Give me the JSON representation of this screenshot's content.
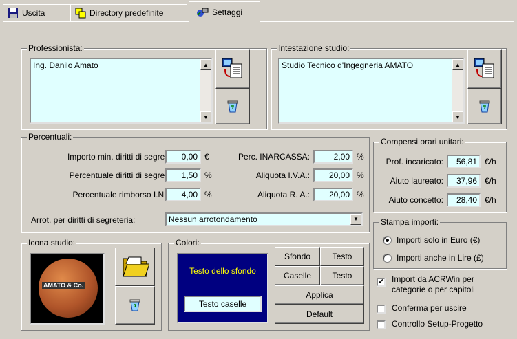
{
  "tabs": [
    {
      "label": "Uscita",
      "icon": "floppy-disk-icon"
    },
    {
      "label": "Directory predefinite",
      "icon": "copy-directory-icon"
    },
    {
      "label": "Settaggi",
      "icon": "settings-icon"
    }
  ],
  "professionista": {
    "legend": "Professionista:",
    "value": "Ing. Danilo Amato"
  },
  "intestazione": {
    "legend": "Intestazione studio:",
    "value": "Studio Tecnico d'Ingegneria AMATO"
  },
  "percentuali": {
    "legend": "Percentuali:",
    "importo_min": {
      "label": "Importo min. diritti di segreteria:",
      "value": "0,00",
      "unit": "€"
    },
    "perc_diritti": {
      "label": "Percentuale diritti di segreteria:",
      "value": "1,50",
      "unit": "%"
    },
    "perc_inps": {
      "label": "Percentuale rimborso I.N.P.S.:",
      "value": "4,00",
      "unit": "%"
    },
    "inarcassa": {
      "label": "Perc. INARCASSA:",
      "value": "2,00",
      "unit": "%"
    },
    "iva": {
      "label": "Aliquota I.V.A.:",
      "value": "20,00",
      "unit": "%"
    },
    "ra": {
      "label": "Aliquota R. A.:",
      "value": "20,00",
      "unit": "%"
    },
    "arrot": {
      "label": "Arrot. per diritti di segreteria:",
      "value": "Nessun arrotondamento"
    }
  },
  "compensi": {
    "legend": "Compensi orari unitari:",
    "rows": [
      {
        "label": "Prof. incaricato:",
        "value": "56,81",
        "unit": "€/h"
      },
      {
        "label": "Aiuto laureato:",
        "value": "37,96",
        "unit": "€/h"
      },
      {
        "label": "Aiuto concetto:",
        "value": "28,40",
        "unit": "€/h"
      }
    ]
  },
  "stampa": {
    "legend": "Stampa importi:",
    "options": [
      "Importi solo in Euro (€)",
      "Importi anche in Lire (£)"
    ],
    "selected": 0
  },
  "icona": {
    "legend": "Icona studio:",
    "logo_text": "AMATO & Co."
  },
  "colori": {
    "legend": "Colori:",
    "preview_text": "Testo dello sfondo",
    "caselle_text": "Testo caselle",
    "sfondo": "Sfondo",
    "testo": "Testo",
    "caselle": "Caselle",
    "testo2": "Testo",
    "applica": "Applica",
    "default": "Default",
    "preview_bg": "#000080",
    "preview_fg": "#ffff00"
  },
  "options": {
    "import_acr": {
      "label": "Import da ACRWin per categorie o per capitoli",
      "checked": true
    },
    "conferma": {
      "label": "Conferma per uscire",
      "checked": false
    },
    "controllo": {
      "label": "Controllo Setup-Progetto",
      "checked": false
    }
  }
}
